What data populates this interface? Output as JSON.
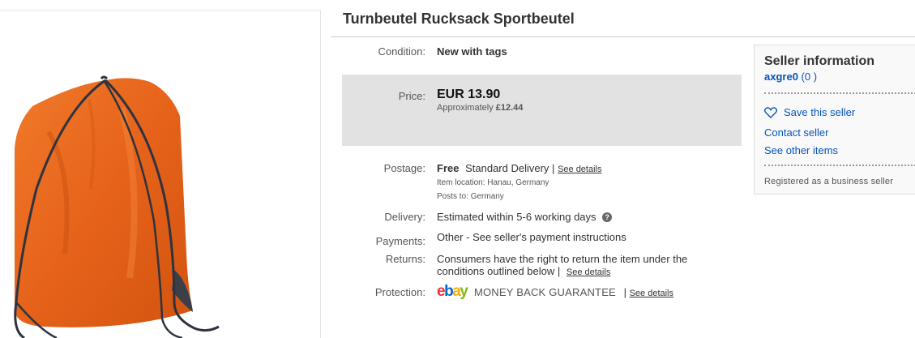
{
  "listing": {
    "title": "Turnbeutel Rucksack Sportbeutel"
  },
  "condition": {
    "label": "Condition:",
    "value": "New with tags"
  },
  "price": {
    "label": "Price:",
    "amount": "EUR 13.90",
    "approx_prefix": "Approximately",
    "approx_amount": "£12.44"
  },
  "postage": {
    "label": "Postage:",
    "free": "Free",
    "method": "Standard Delivery",
    "separator": "|",
    "see_details": "See details",
    "location_label": "Item location:",
    "location": "Hanau, Germany",
    "posts_to_label": "Posts to:",
    "posts_to": "Germany"
  },
  "delivery": {
    "label": "Delivery:",
    "value": "Estimated within 5-6 working days",
    "help_glyph": "?"
  },
  "payments": {
    "label": "Payments:",
    "value": "Other - See seller's payment instructions"
  },
  "returns": {
    "label": "Returns:",
    "line1": "Consumers have the right to return the item under the",
    "line2": "conditions outlined below |",
    "see_details": "See details"
  },
  "protection": {
    "label": "Protection:",
    "logo": {
      "e": "e",
      "b": "b",
      "a": "a",
      "y": "y"
    },
    "guarantee": "MONEY BACK GUARANTEE",
    "separator": "|",
    "see_details": "See details"
  },
  "seller": {
    "title": "Seller information",
    "username": "axgre0",
    "feedback": "(0 )",
    "save_seller": "Save this seller",
    "contact_seller": "Contact seller",
    "other_items": "See other items",
    "note": "Registered as a business seller"
  },
  "colors": {
    "link": "#0654ba",
    "price_box": "#e2e2e2",
    "bag_orange": "#e8661c"
  },
  "icons": [
    "heart-icon",
    "help-icon",
    "product-image"
  ]
}
